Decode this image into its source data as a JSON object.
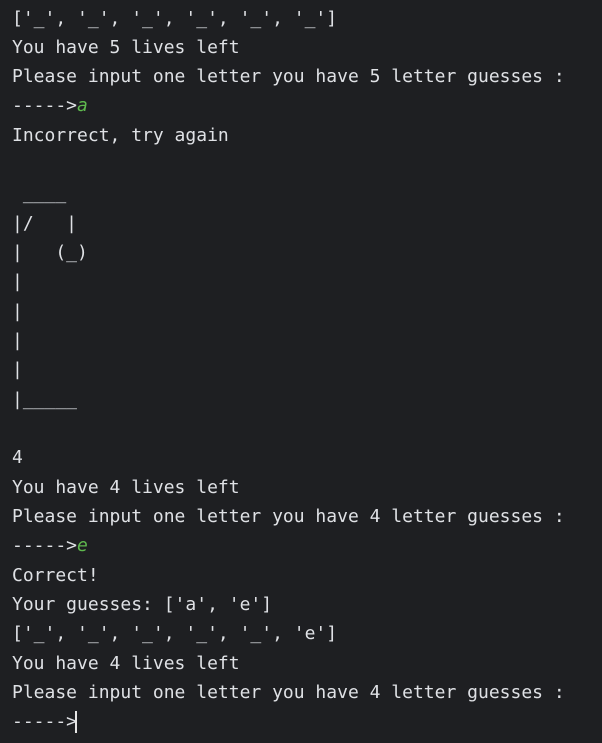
{
  "console": {
    "lines": [
      {
        "text": "['_', '_', '_', '_', '_', '_']"
      },
      {
        "text": "You have 5 lives left"
      },
      {
        "text": "Please input one letter you have 5 letter guesses :"
      },
      {
        "prompt": "----->",
        "input": "a"
      },
      {
        "text": "Incorrect, try again"
      },
      {
        "text": ""
      },
      {
        "text": " ____"
      },
      {
        "text": "|/   |"
      },
      {
        "text": "|   (_)"
      },
      {
        "text": "|"
      },
      {
        "text": "|"
      },
      {
        "text": "|"
      },
      {
        "text": "|"
      },
      {
        "text": "|_____"
      },
      {
        "text": ""
      },
      {
        "text": "4"
      },
      {
        "text": "You have 4 lives left"
      },
      {
        "text": "Please input one letter you have 4 letter guesses :"
      },
      {
        "prompt": "----->",
        "input": "e"
      },
      {
        "text": "Correct!"
      },
      {
        "text": "Your guesses: ['a', 'e']"
      },
      {
        "text": "['_', '_', '_', '_', '_', 'e']"
      },
      {
        "text": "You have 4 lives left"
      },
      {
        "text": "Please input one letter you have 4 letter guesses :"
      },
      {
        "prompt": "----->",
        "input": ""
      }
    ]
  },
  "colors": {
    "background": "#1e1f22",
    "text": "#dfe1e5",
    "user_input": "#5fb94e",
    "caret": "#e6e6e6"
  }
}
